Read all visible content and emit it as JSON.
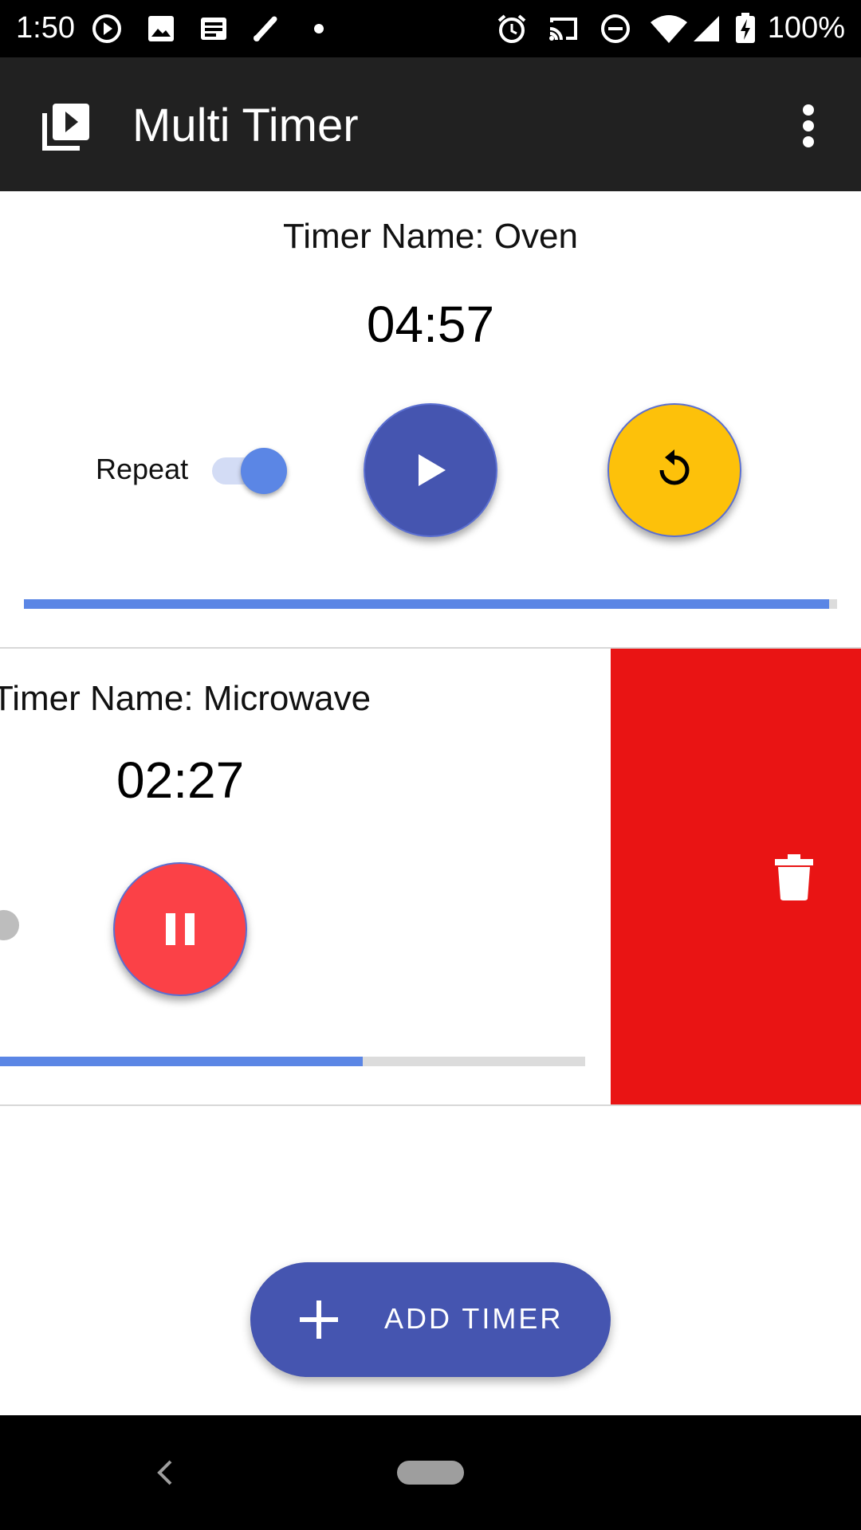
{
  "status_bar": {
    "time": "1:50",
    "battery": "100%",
    "icons_left": [
      "play-circle-icon",
      "image-icon",
      "news-icon",
      "pen-icon",
      "dot-icon"
    ],
    "icons_right": [
      "alarm-icon",
      "cast-icon",
      "do-not-disturb-icon",
      "wifi-icon",
      "signal-icon",
      "battery-charging-icon"
    ]
  },
  "app_bar": {
    "title": "Multi Timer",
    "logo_icon": "video-library-icon",
    "menu_icon": "more-vert-icon"
  },
  "timers": [
    {
      "name": "Timer Name: Oven",
      "time": "04:57",
      "repeat_label": "Repeat",
      "repeat_on": true,
      "state": "paused",
      "progress": 0.99
    },
    {
      "name": "Timer Name: Microwave",
      "time": "02:27",
      "state": "running",
      "progress": 0.62,
      "swiped_to_delete": true
    }
  ],
  "add_button": {
    "label": "ADD TIMER",
    "icon": "plus-icon"
  },
  "colors": {
    "primary": "#4555b0",
    "accent_blue": "#5b86e5",
    "reset": "#fdc10a",
    "pause": "#fb4147",
    "delete": "#e91414",
    "appbar": "#212121"
  }
}
